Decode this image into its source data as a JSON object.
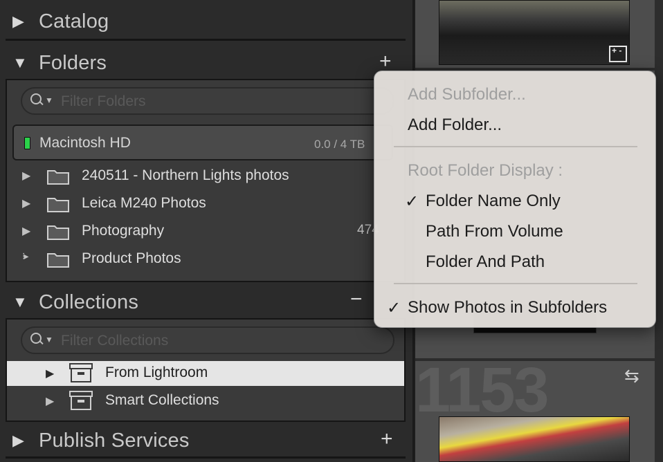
{
  "sections": {
    "catalog": {
      "title": "Catalog"
    },
    "folders": {
      "title": "Folders",
      "filter_placeholder": "Filter Folders"
    },
    "collections": {
      "title": "Collections",
      "filter_placeholder": "Filter Collections"
    },
    "publish": {
      "title": "Publish Services"
    }
  },
  "volume": {
    "name": "Macintosh HD",
    "size": "0.0 / 4 TB"
  },
  "folders": [
    {
      "label": "240511 - Northern Lights photos",
      "count": ""
    },
    {
      "label": "Leica M240 Photos",
      "count": ""
    },
    {
      "label": "Photography",
      "count": "474"
    },
    {
      "label": "Product Photos",
      "count": ""
    }
  ],
  "collections": [
    {
      "label": "From Lightroom",
      "selected": true
    },
    {
      "label": "Smart Collections",
      "selected": false
    }
  ],
  "filmstrip": {
    "number": "1153"
  },
  "menu": {
    "add_subfolder": "Add Subfolder...",
    "add_folder": "Add Folder...",
    "root_heading": "Root Folder Display :",
    "folder_name_only": "Folder Name Only",
    "path_from_volume": "Path From Volume",
    "folder_and_path": "Folder And Path",
    "show_subfolders": "Show Photos in Subfolders",
    "check_glyph": "✓"
  },
  "colors": {
    "accent_led": "#2bd24a",
    "selection": "#e5e5e5"
  }
}
